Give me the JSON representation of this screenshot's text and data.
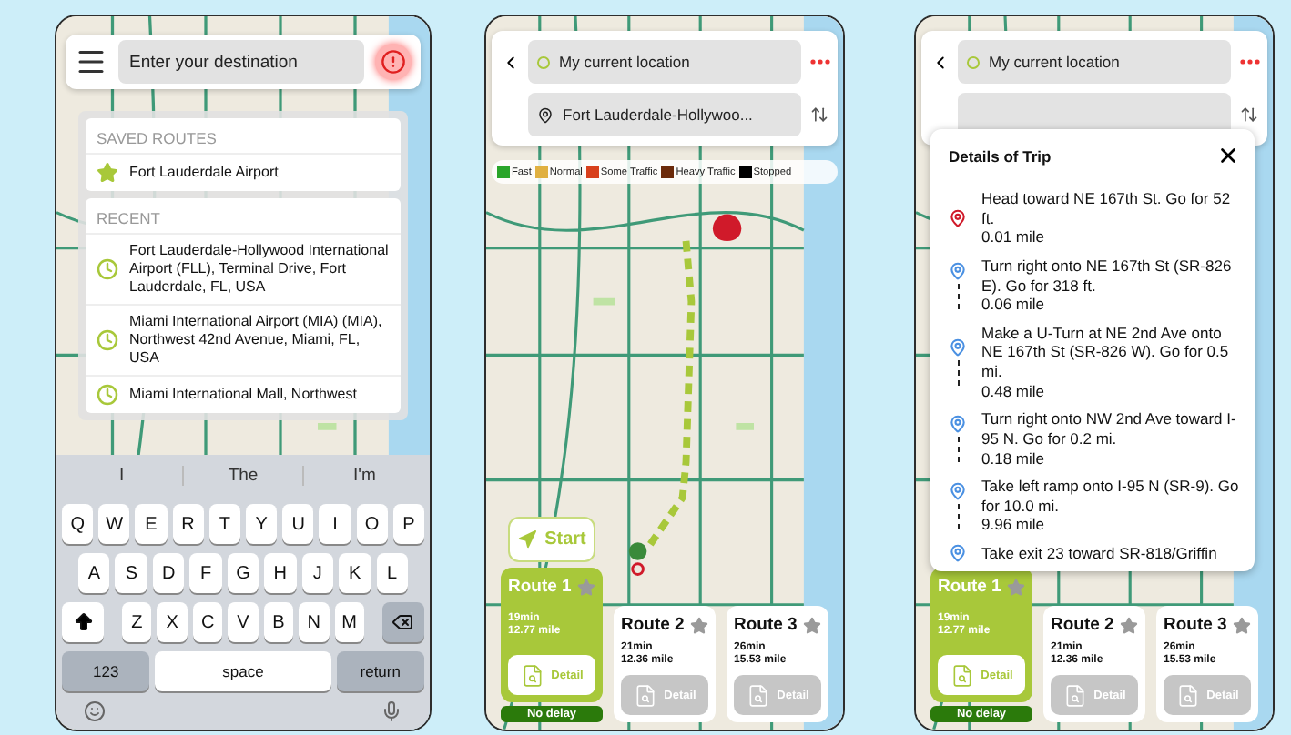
{
  "screens": [
    {
      "kind": "search",
      "search": {
        "placeholder": "Enter your destination"
      },
      "saved_routes": {
        "heading": "SAVED ROUTES",
        "items": [
          "Fort Lauderdale Airport"
        ]
      },
      "recent": {
        "heading": "RECENT",
        "items": [
          "Fort Lauderdale-Hollywood International Airport (FLL), Terminal Drive, Fort Lauderdale, FL, USA",
          "Miami International Airport (MIA) (MIA), Northwest 42nd Avenue, Miami, FL, USA",
          "Miami International Mall, Northwest"
        ]
      },
      "keyboard": {
        "suggestions": [
          "I",
          "The",
          "I'm"
        ],
        "rows": [
          [
            "Q",
            "W",
            "E",
            "R",
            "T",
            "Y",
            "U",
            "I",
            "O",
            "P"
          ],
          [
            "A",
            "S",
            "D",
            "F",
            "G",
            "H",
            "J",
            "K",
            "L"
          ],
          [
            "Z",
            "X",
            "C",
            "V",
            "B",
            "N",
            "M"
          ]
        ],
        "numbers": "123",
        "space": "space",
        "return": "return"
      }
    },
    {
      "kind": "routes",
      "origin": "My current location",
      "destination": "Fort Lauderdale-Hollywoo...",
      "legend": [
        {
          "label": "Fast",
          "color": "#2aa52a"
        },
        {
          "label": "Normal",
          "color": "#e0b040"
        },
        {
          "label": "Some Traffic",
          "color": "#d8401c"
        },
        {
          "label": "Heavy Traffic",
          "color": "#6b2a0a"
        },
        {
          "label": "Stopped",
          "color": "#000000"
        }
      ],
      "start": "Start",
      "routes": [
        {
          "name": "Route 1",
          "time": "19min",
          "distance": "12.77 mile",
          "detail": "Detail",
          "selected": true,
          "badge": "No delay"
        },
        {
          "name": "Route 2",
          "time": "21min",
          "distance": "12.36 mile",
          "detail": "Detail",
          "selected": false
        },
        {
          "name": "Route 3",
          "time": "26min",
          "distance": "15.53 mile",
          "detail": "Detail",
          "selected": false
        }
      ]
    },
    {
      "kind": "details",
      "origin": "My current location",
      "trip": {
        "title": "Details of Trip",
        "steps": [
          {
            "kind": "origin",
            "text": "Head toward NE 167th St. Go for 52 ft.",
            "distance": "0.01 mile"
          },
          {
            "kind": "turn",
            "text": "Turn right onto NE 167th St (SR-826 E). Go for 318 ft.",
            "distance": "0.06 mile"
          },
          {
            "kind": "turn",
            "text": "Make a U-Turn at NE 2nd Ave onto NE 167th St (SR-826 W). Go for 0.5 mi.",
            "distance": "0.48 mile"
          },
          {
            "kind": "turn",
            "text": "Turn right onto NW 2nd Ave toward I-95 N. Go for 0.2 mi.",
            "distance": "0.18 mile"
          },
          {
            "kind": "turn",
            "text": "Take left ramp onto I-95 N (SR-9). Go for 10.0 mi.",
            "distance": "9.96 mile"
          },
          {
            "kind": "turn",
            "text": "Take exit 23 toward SR-818/Griffin"
          }
        ]
      },
      "routes": [
        {
          "name": "Route 1",
          "time": "19min",
          "distance": "12.77 mile",
          "detail": "Detail",
          "selected": true,
          "badge": "No delay"
        },
        {
          "name": "Route 2",
          "time": "21min",
          "distance": "12.36 mile",
          "detail": "Detail",
          "selected": false
        },
        {
          "name": "Route 3",
          "time": "26min",
          "distance": "15.53 mile",
          "detail": "Detail",
          "selected": false
        }
      ]
    }
  ]
}
